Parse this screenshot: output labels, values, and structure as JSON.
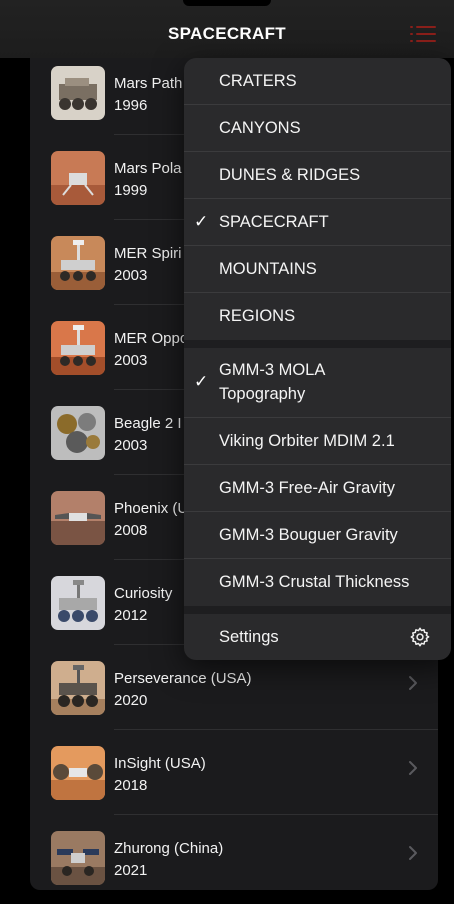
{
  "header": {
    "title": "SPACECRAFT",
    "menu_icon": "list-icon"
  },
  "missions": [
    {
      "name": "Mars Path",
      "year": "1996",
      "icon": "rover-icon"
    },
    {
      "name": "Mars Pola",
      "year": "1999",
      "icon": "lander-icon"
    },
    {
      "name": "MER Spiri",
      "year": "2003",
      "icon": "rover-icon"
    },
    {
      "name": "MER Oppo",
      "year": "2003",
      "icon": "rover-icon"
    },
    {
      "name": "Beagle 2 I",
      "year": "2003",
      "icon": "lander-icon"
    },
    {
      "name": "Phoenix (U",
      "year": "2008",
      "icon": "lander-icon"
    },
    {
      "name": "Curiosity",
      "year": "2012",
      "icon": "rover-icon"
    },
    {
      "name": "Perseverance (USA)",
      "year": "2020",
      "icon": "rover-icon"
    },
    {
      "name": "InSight (USA)",
      "year": "2018",
      "icon": "lander-icon"
    },
    {
      "name": "Zhurong (China)",
      "year": "2021",
      "icon": "rover-icon"
    }
  ],
  "menu": {
    "features": [
      {
        "label": "CRATERS",
        "checked": false
      },
      {
        "label": "CANYONS",
        "checked": false
      },
      {
        "label": "DUNES & RIDGES",
        "checked": false
      },
      {
        "label": "SPACECRAFT",
        "checked": true
      },
      {
        "label": "MOUNTAINS",
        "checked": false
      },
      {
        "label": "REGIONS",
        "checked": false
      }
    ],
    "maps": [
      {
        "label_lines": [
          "GMM-3 MOLA",
          "Topography"
        ],
        "checked": true
      },
      {
        "label": "Viking Orbiter MDIM 2.1",
        "checked": false
      },
      {
        "label": "GMM-3 Free-Air Gravity",
        "checked": false
      },
      {
        "label": "GMM-3 Bouguer Gravity",
        "checked": false
      },
      {
        "label": "GMM-3 Crustal Thickness",
        "checked": false
      }
    ],
    "settings_label": "Settings",
    "settings_icon": "gear-icon",
    "check_glyph": "✓"
  },
  "colors": {
    "accent": "#8a1f1a",
    "menu_bg": "#2a2a2c",
    "list_bg": "#1b1b1d"
  }
}
